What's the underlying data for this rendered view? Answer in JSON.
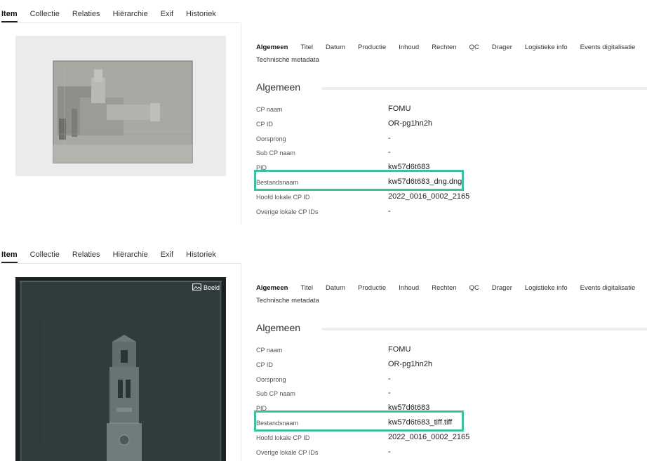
{
  "panels": [
    {
      "left_tabs": [
        {
          "label": "Item",
          "active": true
        },
        {
          "label": "Collectie",
          "active": false
        },
        {
          "label": "Relaties",
          "active": false
        },
        {
          "label": "Hiërarchie",
          "active": false
        },
        {
          "label": "Exif",
          "active": false
        },
        {
          "label": "Historiek",
          "active": false
        }
      ],
      "image_badge": "",
      "right_tabs": [
        "Algemeen",
        "Titel",
        "Datum",
        "Productie",
        "Inhoud",
        "Rechten",
        "QC",
        "Drager",
        "Logistieke info",
        "Events digitalisatie"
      ],
      "right_tabs_row2": [
        "Technische metadata"
      ],
      "section_title": "Algemeen",
      "fields": [
        {
          "label": "CP naam",
          "value": "FOMU"
        },
        {
          "label": "CP ID",
          "value": "OR-pg1hn2h"
        },
        {
          "label": "Oorsprong",
          "value": "-"
        },
        {
          "label": "Sub CP naam",
          "value": "-"
        },
        {
          "label": "PID",
          "value": "kw57d6t683"
        },
        {
          "label": "Bestandsnaam",
          "value": "kw57d6t683_dng.dng"
        },
        {
          "label": "Hoofd lokale CP ID",
          "value": "2022_0016_0002_2165"
        },
        {
          "label": "Overige lokale CP IDs",
          "value": "-"
        }
      ]
    },
    {
      "left_tabs": [
        {
          "label": "Item",
          "active": true
        },
        {
          "label": "Collectie",
          "active": false
        },
        {
          "label": "Relaties",
          "active": false
        },
        {
          "label": "Hiërarchie",
          "active": false
        },
        {
          "label": "Exif",
          "active": false
        },
        {
          "label": "Historiek",
          "active": false
        }
      ],
      "image_badge": "Beeld",
      "right_tabs": [
        "Algemeen",
        "Titel",
        "Datum",
        "Productie",
        "Inhoud",
        "Rechten",
        "QC",
        "Drager",
        "Logistieke info",
        "Events digitalisatie"
      ],
      "right_tabs_row2": [
        "Technische metadata"
      ],
      "section_title": "Algemeen",
      "fields": [
        {
          "label": "CP naam",
          "value": "FOMU"
        },
        {
          "label": "CP ID",
          "value": "OR-pg1hn2h"
        },
        {
          "label": "Oorsprong",
          "value": "-"
        },
        {
          "label": "Sub CP naam",
          "value": "-"
        },
        {
          "label": "PID",
          "value": "kw57d6t683"
        },
        {
          "label": "Bestandsnaam",
          "value": "kw57d6t683_tiff.tiff"
        },
        {
          "label": "Hoofd lokale CP ID",
          "value": "2022_0016_0002_2165"
        },
        {
          "label": "Overige lokale CP IDs",
          "value": "-"
        }
      ]
    }
  ],
  "colors": {
    "highlight": "#3dbfa0"
  },
  "icons": {
    "image_badge": "image-icon"
  }
}
